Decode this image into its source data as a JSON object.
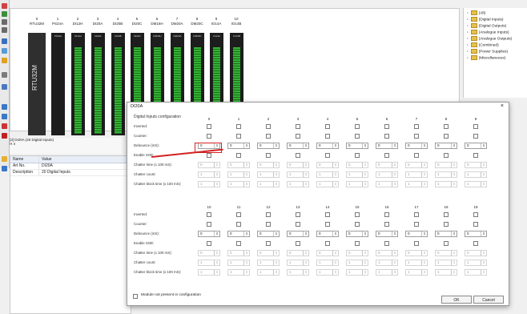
{
  "rack": {
    "slots": [
      {
        "num": "0",
        "name": "RTU32M"
      },
      {
        "num": "1",
        "name": "PS24A"
      },
      {
        "num": "2",
        "name": "DI12H"
      },
      {
        "num": "3",
        "name": "DI20A"
      },
      {
        "num": "4",
        "name": "DI20B"
      },
      {
        "num": "5",
        "name": "DI20C"
      },
      {
        "num": "6",
        "name": "DM16H"
      },
      {
        "num": "7",
        "name": "DM20A"
      },
      {
        "num": "8",
        "name": "DM20C"
      },
      {
        "num": "9",
        "name": "IO14A"
      },
      {
        "num": "10",
        "name": "IO14B"
      }
    ],
    "cpu_label": "RTU32M"
  },
  "module_info": {
    "line1": "[3] DI20A (20 Digital Inputs)",
    "line2": "H  4"
  },
  "properties": {
    "headers": [
      "Name",
      "Value"
    ],
    "rows": [
      {
        "name": "Art No.",
        "value": "DI20A"
      },
      {
        "name": "Description",
        "value": "20 Digital Inputs"
      }
    ]
  },
  "tree": {
    "items": [
      "(All)",
      "(Digital Inputs)",
      "(Digital Outputs)",
      "(Analogue Inputs)",
      "(Analogue Outputs)",
      "(Combined)",
      "(Power Supplies)",
      "(Miscellaneous)"
    ]
  },
  "dialog": {
    "title": "DI20A",
    "close": "×",
    "group_title": "Digital Inputs configuration",
    "row_labels": [
      "Inverted:",
      "Counter:",
      "Debounce (mS):",
      "Enable SOE:",
      "Chatter time (x 100 mS):",
      "Chatter count:",
      "Chatter block time (x 100 mS):"
    ],
    "top_channels": [
      "0",
      "1",
      "2",
      "3",
      "4",
      "5",
      "6",
      "7",
      "8",
      "9"
    ],
    "bottom_channels": [
      "10",
      "11",
      "12",
      "13",
      "14",
      "15",
      "16",
      "17",
      "18",
      "19"
    ],
    "debounce_value": "0",
    "chatter_time_value": "0",
    "chatter_count_value": "1",
    "chatter_block_value": "1",
    "not_present_label": "Module not present in configuration",
    "ok": "OK",
    "cancel": "Cancel"
  },
  "colors": {
    "accent": "#d22222",
    "io_green": "#32b432",
    "folder": "#e8c14a"
  }
}
